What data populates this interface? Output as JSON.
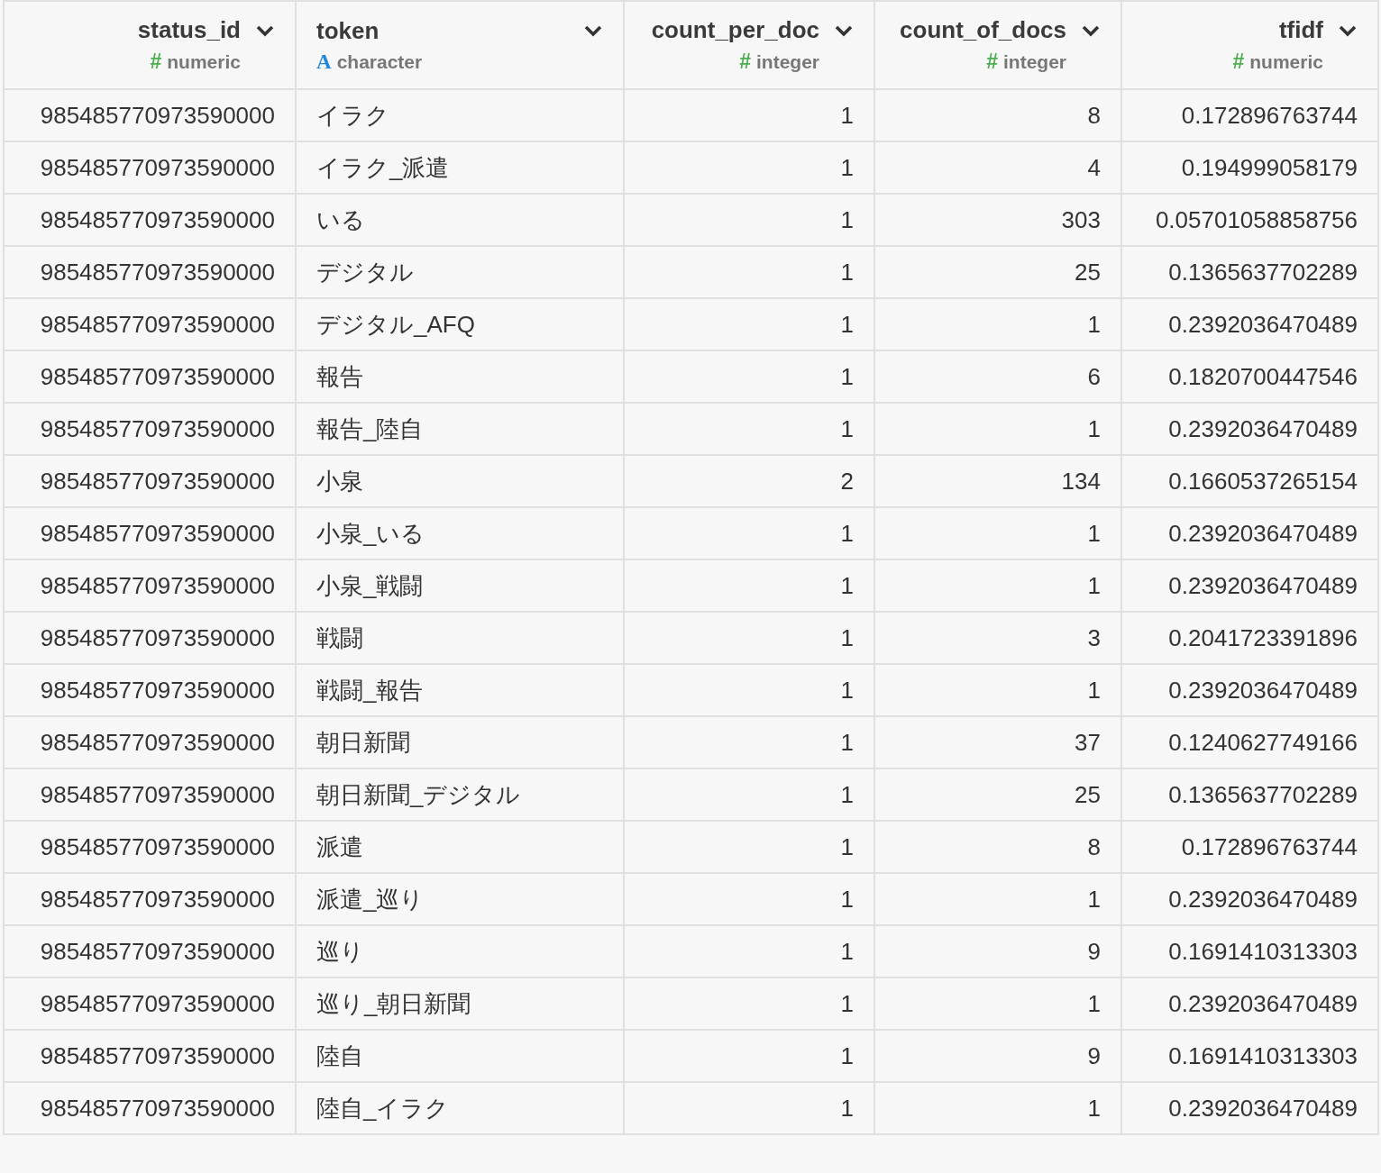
{
  "columns": [
    {
      "name": "status_id",
      "type_symbol": "#",
      "type": "numeric",
      "kind": "number"
    },
    {
      "name": "token",
      "type_symbol": "A",
      "type": "character",
      "kind": "text"
    },
    {
      "name": "count_per_doc",
      "type_symbol": "#",
      "type": "integer",
      "kind": "number"
    },
    {
      "name": "count_of_docs",
      "type_symbol": "#",
      "type": "integer",
      "kind": "number"
    },
    {
      "name": "tfidf",
      "type_symbol": "#",
      "type": "numeric",
      "kind": "number"
    }
  ],
  "rows": [
    [
      "985485770973590000",
      "イラク",
      "1",
      "8",
      "0.172896763744"
    ],
    [
      "985485770973590000",
      "イラク_派遣",
      "1",
      "4",
      "0.194999058179"
    ],
    [
      "985485770973590000",
      "いる",
      "1",
      "303",
      "0.05701058858756"
    ],
    [
      "985485770973590000",
      "デジタル",
      "1",
      "25",
      "0.1365637702289"
    ],
    [
      "985485770973590000",
      "デジタル_AFQ",
      "1",
      "1",
      "0.2392036470489"
    ],
    [
      "985485770973590000",
      "報告",
      "1",
      "6",
      "0.1820700447546"
    ],
    [
      "985485770973590000",
      "報告_陸自",
      "1",
      "1",
      "0.2392036470489"
    ],
    [
      "985485770973590000",
      "小泉",
      "2",
      "134",
      "0.1660537265154"
    ],
    [
      "985485770973590000",
      "小泉_いる",
      "1",
      "1",
      "0.2392036470489"
    ],
    [
      "985485770973590000",
      "小泉_戦闘",
      "1",
      "1",
      "0.2392036470489"
    ],
    [
      "985485770973590000",
      "戦闘",
      "1",
      "3",
      "0.2041723391896"
    ],
    [
      "985485770973590000",
      "戦闘_報告",
      "1",
      "1",
      "0.2392036470489"
    ],
    [
      "985485770973590000",
      "朝日新聞",
      "1",
      "37",
      "0.1240627749166"
    ],
    [
      "985485770973590000",
      "朝日新聞_デジタル",
      "1",
      "25",
      "0.1365637702289"
    ],
    [
      "985485770973590000",
      "派遣",
      "1",
      "8",
      "0.172896763744"
    ],
    [
      "985485770973590000",
      "派遣_巡り",
      "1",
      "1",
      "0.2392036470489"
    ],
    [
      "985485770973590000",
      "巡り",
      "1",
      "9",
      "0.1691410313303"
    ],
    [
      "985485770973590000",
      "巡り_朝日新聞",
      "1",
      "1",
      "0.2392036470489"
    ],
    [
      "985485770973590000",
      "陸自",
      "1",
      "9",
      "0.1691410313303"
    ],
    [
      "985485770973590000",
      "陸自_イラク",
      "1",
      "1",
      "0.2392036470489"
    ]
  ]
}
